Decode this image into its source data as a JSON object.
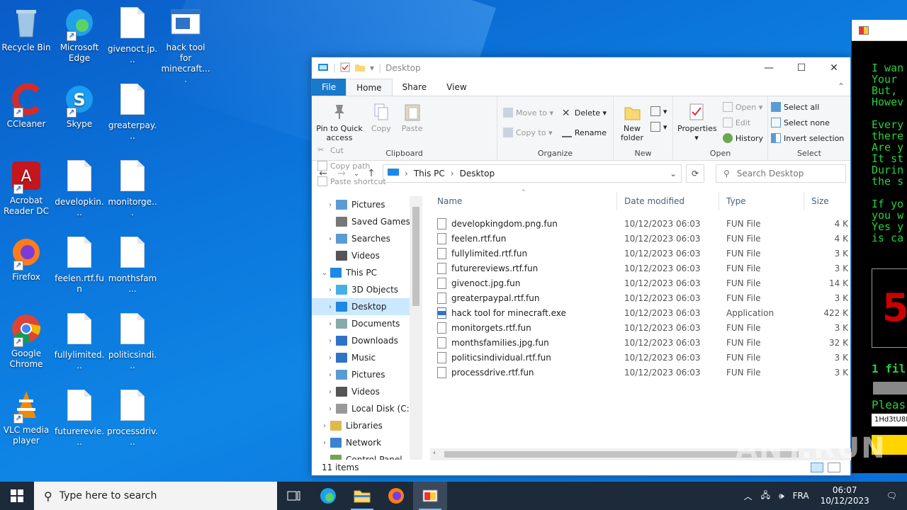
{
  "desktop": {
    "icons": [
      {
        "label": "Recycle Bin",
        "icon": "recycle-bin-icon"
      },
      {
        "label": "Microsoft Edge",
        "icon": "edge-icon"
      },
      {
        "label": "givenoct.jp...",
        "icon": "file-icon"
      },
      {
        "label": "hack tool for minecraft....",
        "icon": "exe-icon"
      },
      {
        "label": "CCleaner",
        "icon": "ccleaner-icon"
      },
      {
        "label": "Skype",
        "icon": "skype-icon"
      },
      {
        "label": "greaterpay...",
        "icon": "file-icon"
      },
      {
        "label": "Acrobat Reader DC",
        "icon": "acrobat-icon"
      },
      {
        "label": "developkin...",
        "icon": "file-icon"
      },
      {
        "label": "monitorge...",
        "icon": "file-icon"
      },
      {
        "label": "Firefox",
        "icon": "firefox-icon"
      },
      {
        "label": "feelen.rtf.fun",
        "icon": "file-icon"
      },
      {
        "label": "monthsfam...",
        "icon": "file-icon"
      },
      {
        "label": "Google Chrome",
        "icon": "chrome-icon"
      },
      {
        "label": "fullylimited...",
        "icon": "file-icon"
      },
      {
        "label": "politicsindi...",
        "icon": "file-icon"
      },
      {
        "label": "VLC media player",
        "icon": "vlc-icon"
      },
      {
        "label": "futurerevie...",
        "icon": "file-icon"
      },
      {
        "label": "processdriv...",
        "icon": "file-icon"
      }
    ]
  },
  "explorer": {
    "title": "Desktop",
    "tabs": [
      "File",
      "Home",
      "Share",
      "View"
    ],
    "ribbon": {
      "clipboard": {
        "name": "Clipboard",
        "pin": "Pin to Quick access",
        "copy": "Copy",
        "paste": "Paste",
        "cut": "Cut",
        "copy_path": "Copy path",
        "paste_shortcut": "Paste shortcut"
      },
      "organize": {
        "name": "Organize",
        "move_to": "Move to",
        "copy_to": "Copy to",
        "delete": "Delete",
        "rename": "Rename"
      },
      "new": {
        "name": "New",
        "new_folder": "New folder"
      },
      "open": {
        "name": "Open",
        "properties": "Properties",
        "open": "Open",
        "edit": "Edit",
        "history": "History"
      },
      "select": {
        "name": "Select",
        "select_all": "Select all",
        "select_none": "Select none",
        "invert": "Invert selection"
      }
    },
    "address": {
      "root": "This PC",
      "current": "Desktop"
    },
    "search_placeholder": "Search Desktop",
    "nav": [
      {
        "label": "Pictures",
        "indent": 1,
        "chev": "›",
        "icon": "pictures-icon"
      },
      {
        "label": "Saved Games",
        "indent": 1,
        "chev": "",
        "icon": "saved-games-icon"
      },
      {
        "label": "Searches",
        "indent": 1,
        "chev": "›",
        "icon": "search-icon"
      },
      {
        "label": "Videos",
        "indent": 1,
        "chev": "",
        "icon": "videos-icon"
      },
      {
        "label": "This PC",
        "indent": 0,
        "chev": "⌄",
        "icon": "this-pc-icon"
      },
      {
        "label": "3D Objects",
        "indent": 1,
        "chev": "›",
        "icon": "3d-objects-icon"
      },
      {
        "label": "Desktop",
        "indent": 1,
        "chev": "›",
        "icon": "desktop-icon",
        "selected": true
      },
      {
        "label": "Documents",
        "indent": 1,
        "chev": "›",
        "icon": "documents-icon"
      },
      {
        "label": "Downloads",
        "indent": 1,
        "chev": "›",
        "icon": "downloads-icon"
      },
      {
        "label": "Music",
        "indent": 1,
        "chev": "›",
        "icon": "music-icon"
      },
      {
        "label": "Pictures",
        "indent": 1,
        "chev": "›",
        "icon": "pictures-icon"
      },
      {
        "label": "Videos",
        "indent": 1,
        "chev": "›",
        "icon": "videos-icon"
      },
      {
        "label": "Local Disk (C:)",
        "indent": 1,
        "chev": "›",
        "icon": "disk-icon"
      },
      {
        "label": "Libraries",
        "indent": 0,
        "chev": "›",
        "icon": "libraries-icon"
      },
      {
        "label": "Network",
        "indent": 0,
        "chev": "›",
        "icon": "network-icon"
      },
      {
        "label": "Control Panel",
        "indent": 0,
        "chev": "⌄",
        "icon": "control-panel-icon"
      }
    ],
    "columns": [
      "Name",
      "Date modified",
      "Type",
      "Size"
    ],
    "files": [
      {
        "name": "developkingdom.png.fun",
        "date": "10/12/2023 06:03",
        "type": "FUN File",
        "size": "4 K"
      },
      {
        "name": "feelen.rtf.fun",
        "date": "10/12/2023 06:03",
        "type": "FUN File",
        "size": "4 K"
      },
      {
        "name": "fullylimited.rtf.fun",
        "date": "10/12/2023 06:03",
        "type": "FUN File",
        "size": "3 K"
      },
      {
        "name": "futurereviews.rtf.fun",
        "date": "10/12/2023 06:03",
        "type": "FUN File",
        "size": "3 K"
      },
      {
        "name": "givenoct.jpg.fun",
        "date": "10/12/2023 06:03",
        "type": "FUN File",
        "size": "14 K"
      },
      {
        "name": "greaterpaypal.rtf.fun",
        "date": "10/12/2023 06:03",
        "type": "FUN File",
        "size": "3 K"
      },
      {
        "name": "hack tool for minecraft.exe",
        "date": "10/12/2023 06:03",
        "type": "Application",
        "size": "422 K",
        "exe": true
      },
      {
        "name": "monitorgets.rtf.fun",
        "date": "10/12/2023 06:03",
        "type": "FUN File",
        "size": "3 K"
      },
      {
        "name": "monthsfamilies.jpg.fun",
        "date": "10/12/2023 06:03",
        "type": "FUN File",
        "size": "32 K"
      },
      {
        "name": "politicsindividual.rtf.fun",
        "date": "10/12/2023 06:03",
        "type": "FUN File",
        "size": "3 K"
      },
      {
        "name": "processdrive.rtf.fun",
        "date": "10/12/2023 06:03",
        "type": "FUN File",
        "size": "3 K"
      }
    ],
    "status": "11 items"
  },
  "ransom": {
    "lines": [
      "I wan",
      "Your ",
      "But, ",
      "Howev",
      "",
      "Every",
      "there",
      "Are y",
      "It st",
      "Durin",
      "the s",
      "",
      "If yo",
      "you w",
      "Yes y",
      "is ca"
    ],
    "timer": "5",
    "files_text": "1 fil",
    "please_text": "Pleas",
    "address": "1Hd3tU8M"
  },
  "watermark": "ANY.RUN",
  "taskbar": {
    "search_placeholder": "Type here to search",
    "language": "FRA",
    "time": "06:07",
    "date": "10/12/2023"
  }
}
